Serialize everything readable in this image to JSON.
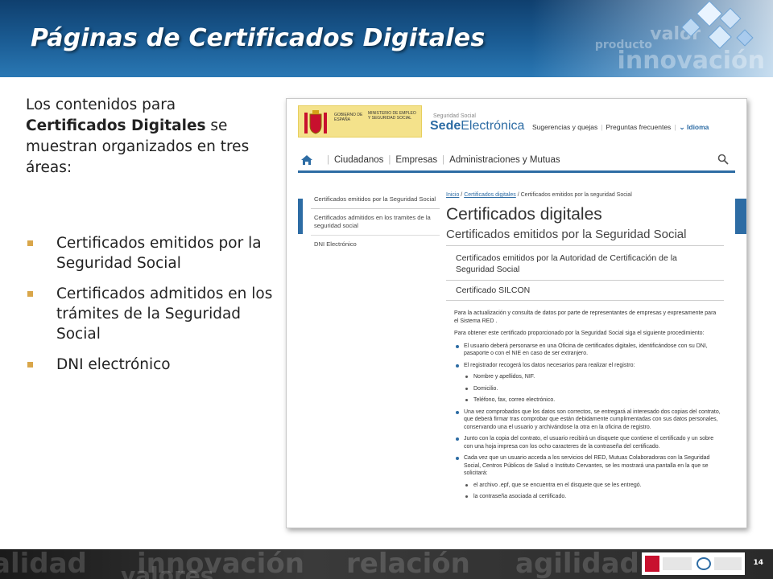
{
  "slide": {
    "title": "Páginas de Certificados Digitales",
    "intro_before": "Los contenidos para ",
    "intro_bold": "Certificados Digitales",
    "intro_after": " se muestran organizados en tres áreas:",
    "bullets": [
      "Certificados emitidos por la Seguridad Social",
      "Certificados admitidos en los trámites de la Seguridad Social",
      "DNI electrónico"
    ],
    "header_words": [
      "valor",
      "producto",
      "innovación"
    ],
    "footer_words": [
      "alidad",
      "innovación",
      "valores",
      "relación",
      "agilidad"
    ],
    "page_number": "14",
    "colors": {
      "header_blue": "#1b5d95",
      "bullet_gold": "#d9a64a",
      "sede_blue": "#2d6ca4"
    }
  },
  "screenshot": {
    "gov": {
      "line1": "GOBIERNO DE ESPAÑA",
      "line2": "MINISTERIO DE EMPLEO Y SEGURIDAD SOCIAL"
    },
    "sede_small": "Seguridad Social",
    "sede_part1": "Sede",
    "sede_part2": "Electrónica",
    "toplinks": {
      "sugerencias": "Sugerencias y quejas",
      "preguntas": "Preguntas frecuentes",
      "idioma": "Idioma"
    },
    "nav": {
      "ciudadanos": "Ciudadanos",
      "empresas": "Empresas",
      "administraciones": "Administraciones y Mutuas"
    },
    "sidebar": [
      "Certificados emitidos por la Seguridad Social",
      "Certificados admitidos en los tramites de la seguridad social",
      "DNI Electrónico"
    ],
    "breadcrumb": {
      "inicio": "Inicio",
      "certificados": "Certificados digitales",
      "current": "Certificados emitidos por la seguridad Social"
    },
    "h1": "Certificados digitales",
    "h2": "Certificados emitidos por la Seguridad Social",
    "section1": "Certificados emitidos por la Autoridad de Certificación de la Seguridad Social",
    "section2": "Certificado SILCON",
    "para1": "Para la actualización y consulta de datos por parte de representantes de empresas y expresamente para el Sistema RED .",
    "para2": "Para obtener este certificado proporcionado por la Seguridad Social siga el siguiente procedimiento:",
    "steps": [
      {
        "text": "El usuario deberá personarse en una Oficina de certificados digitales, identificándose con su DNI, pasaporte o con el NIE en caso de ser extranjero.",
        "sub": []
      },
      {
        "text": "El registrador recogerá los datos necesarios para realizar el registro:",
        "sub": [
          "Nombre y apellidos, NIF.",
          "Domicilio.",
          "Teléfono, fax, correo electrónico."
        ]
      },
      {
        "text": "Una vez comprobados que los datos son correctos, se entregará al interesado dos copias del contrato, que deberá firmar tras comprobar que están debidamente cumplimentadas con sus datos personales, conservando una el usuario y archivándose la otra en la oficina de registro.",
        "sub": []
      },
      {
        "text": "Junto con la copia del contrato, el usuario recibirá un disquete que contiene el certificado y un sobre con una hoja impresa con los ocho caracteres de la contraseña del certificado.",
        "sub": []
      },
      {
        "text": "Cada vez que un usuario acceda a los servicios del RED, Mutuas Colaboradoras con la Seguridad Social, Centros Públicos de Salud o Instituto Cervantes, se les mostrará una pantalla en la que se solicitará:",
        "sub": [
          "el archivo .epf, que se encuentra en el disquete que se les entregó.",
          "la contraseña asociada al certificado."
        ]
      }
    ]
  }
}
